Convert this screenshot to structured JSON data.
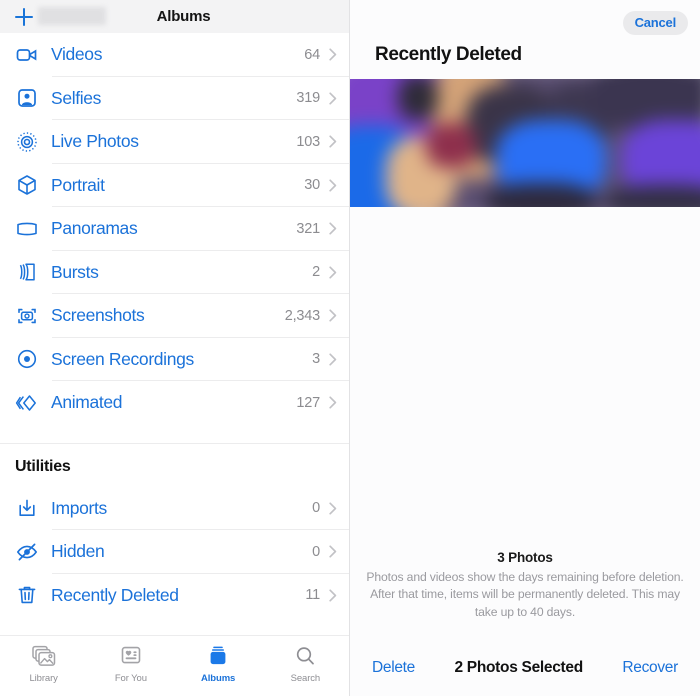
{
  "left": {
    "header": {
      "title": "Albums",
      "add_icon": "plus-icon",
      "redacted_label": ""
    },
    "albums": [
      {
        "name": "Videos",
        "count": "64",
        "icon": "video-camera-icon"
      },
      {
        "name": "Selfies",
        "count": "319",
        "icon": "person-portrait-icon"
      },
      {
        "name": "Live Photos",
        "count": "103",
        "icon": "live-photo-icon"
      },
      {
        "name": "Portrait",
        "count": "30",
        "icon": "cube-icon"
      },
      {
        "name": "Panoramas",
        "count": "321",
        "icon": "panorama-icon"
      },
      {
        "name": "Bursts",
        "count": "2",
        "icon": "burst-stack-icon"
      },
      {
        "name": "Screenshots",
        "count": "2,343",
        "icon": "screenshot-camera-icon"
      },
      {
        "name": "Screen Recordings",
        "count": "3",
        "icon": "record-circle-icon"
      },
      {
        "name": "Animated",
        "count": "127",
        "icon": "animated-chevrons-icon"
      }
    ],
    "utilities_title": "Utilities",
    "utilities": [
      {
        "name": "Imports",
        "count": "0",
        "icon": "import-download-icon"
      },
      {
        "name": "Hidden",
        "count": "0",
        "icon": "eye-slash-icon"
      },
      {
        "name": "Recently Deleted",
        "count": "11",
        "icon": "trash-icon"
      }
    ],
    "tabs": [
      {
        "label": "Library",
        "icon": "photos-stack-icon",
        "active": false
      },
      {
        "label": "For You",
        "icon": "for-you-card-icon",
        "active": false
      },
      {
        "label": "Albums",
        "icon": "albums-book-icon",
        "active": true
      },
      {
        "label": "Search",
        "icon": "search-icon",
        "active": false
      }
    ]
  },
  "right": {
    "cancel_label": "Cancel",
    "title": "Recently Deleted",
    "photos_count": "3 Photos",
    "description": "Photos and videos show the days remaining before deletion. After that time, items will be permanently deleted. This may take up to 40 days.",
    "toolbar": {
      "delete_label": "Delete",
      "status_label": "2 Photos Selected",
      "recover_label": "Recover"
    }
  },
  "colors": {
    "accent_blue": "#1b72d9",
    "header_bg": "#f3f3f4",
    "secondary_text": "#8c8c90",
    "tab_inactive": "#8e8e93"
  }
}
